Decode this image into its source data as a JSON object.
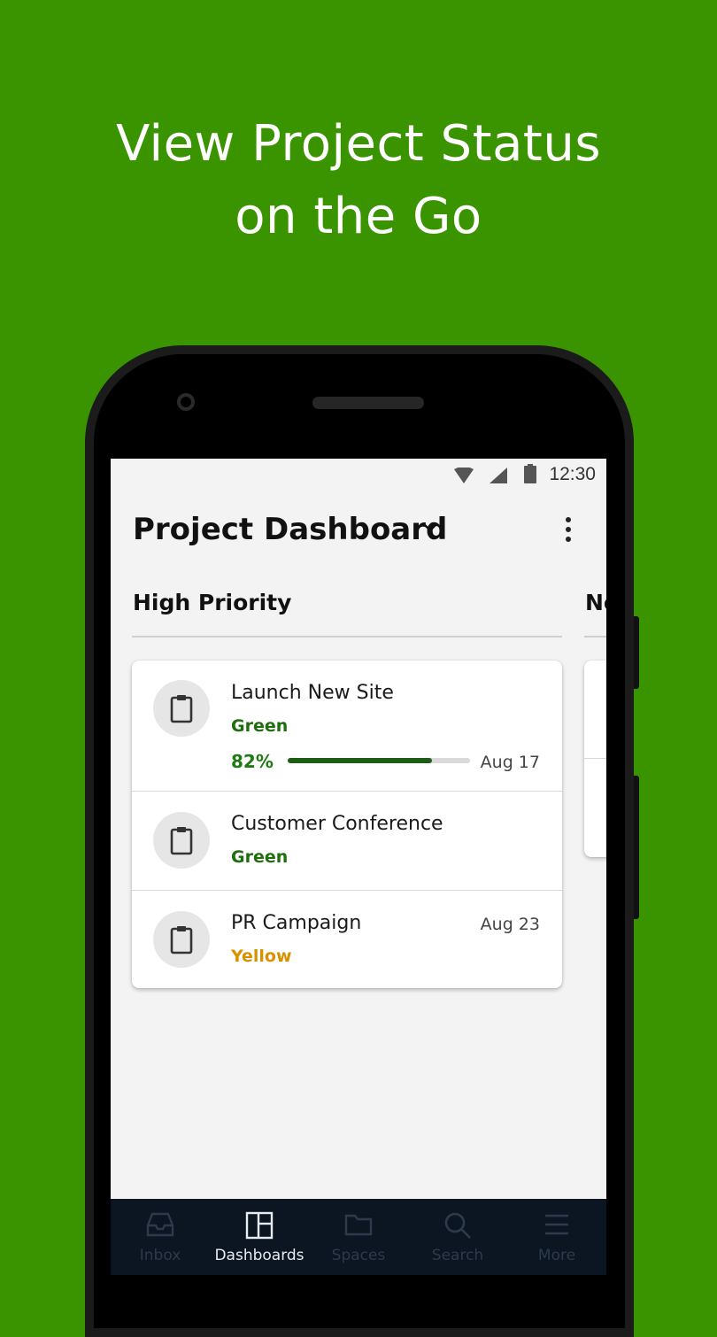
{
  "headline": {
    "line1": "View Project Status",
    "line2": "on the Go"
  },
  "status_bar": {
    "time": "12:30"
  },
  "app_bar": {
    "title": "Project Dashboard"
  },
  "columns": [
    {
      "header": "High Priority"
    },
    {
      "header": "No"
    }
  ],
  "projects": [
    {
      "title": "Launch New Site",
      "status": "Green",
      "status_color": "#1e6e0d",
      "percent": "82%",
      "progress": 0.79,
      "date": "Aug 17"
    },
    {
      "title": "Customer Conference",
      "status": "Green",
      "status_color": "#1e6e0d",
      "date": ""
    },
    {
      "title": "PR Campaign",
      "status": "Yellow",
      "status_color": "#d99100",
      "date": "Aug 23"
    }
  ],
  "nav": [
    {
      "label": "Inbox",
      "icon": "inbox-icon",
      "active": false
    },
    {
      "label": "Dashboards",
      "icon": "dashboards-icon",
      "active": true
    },
    {
      "label": "Spaces",
      "icon": "folder-icon",
      "active": false
    },
    {
      "label": "Search",
      "icon": "search-icon",
      "active": false
    },
    {
      "label": "More",
      "icon": "menu-icon",
      "active": false
    }
  ],
  "colors": {
    "background": "#3a9400",
    "nav_background": "#0c1522",
    "progress_fill": "#1e5d16"
  }
}
